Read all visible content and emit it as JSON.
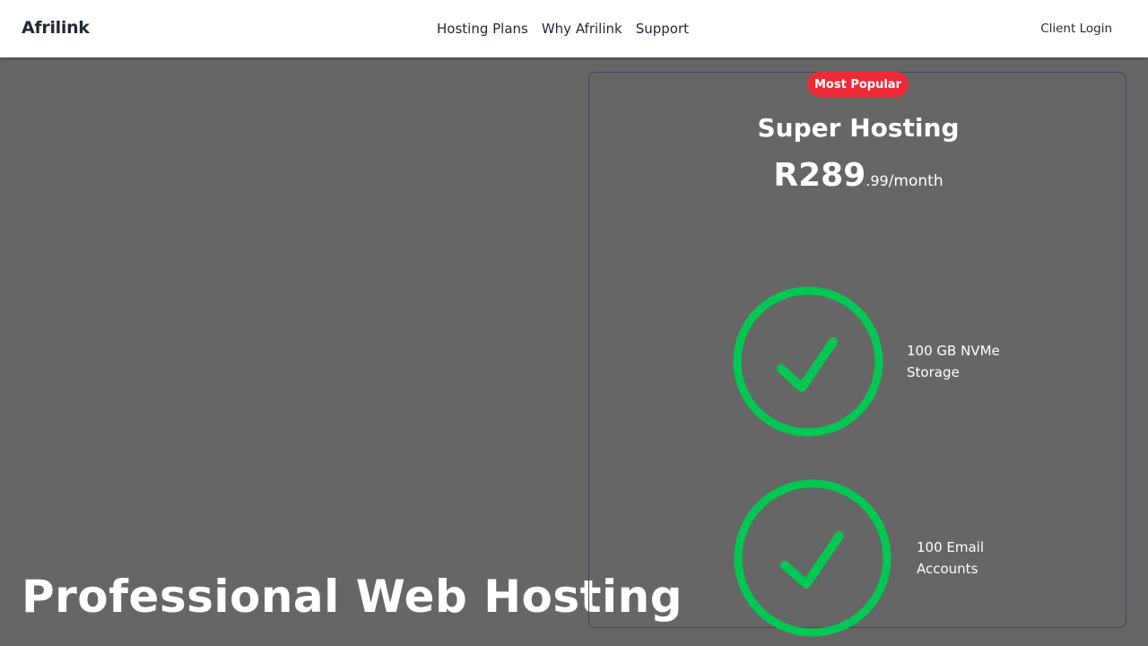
{
  "nav": {
    "brand": "Afrilink",
    "links": [
      {
        "label": "Hosting Plans"
      },
      {
        "label": "Why Afrilink"
      },
      {
        "label": "Support"
      }
    ],
    "client_login": "Client Login"
  },
  "hero": {
    "title": "Professional Web Hosting"
  },
  "plan": {
    "badge": "Most Popular",
    "name": "Super Hosting",
    "price_main": "R289",
    "price_cents": ".99",
    "price_period": "/month",
    "features": [
      {
        "text": "100 GB NVMe Storage",
        "icon": "check-circle-icon"
      },
      {
        "text": "100 Email Accounts",
        "icon": "check-circle-icon"
      }
    ]
  },
  "colors": {
    "background": "#666666",
    "navbar": "#ffffff",
    "badge": "#ef2a38",
    "check": "#00c853",
    "card_border": "#3f4660"
  }
}
